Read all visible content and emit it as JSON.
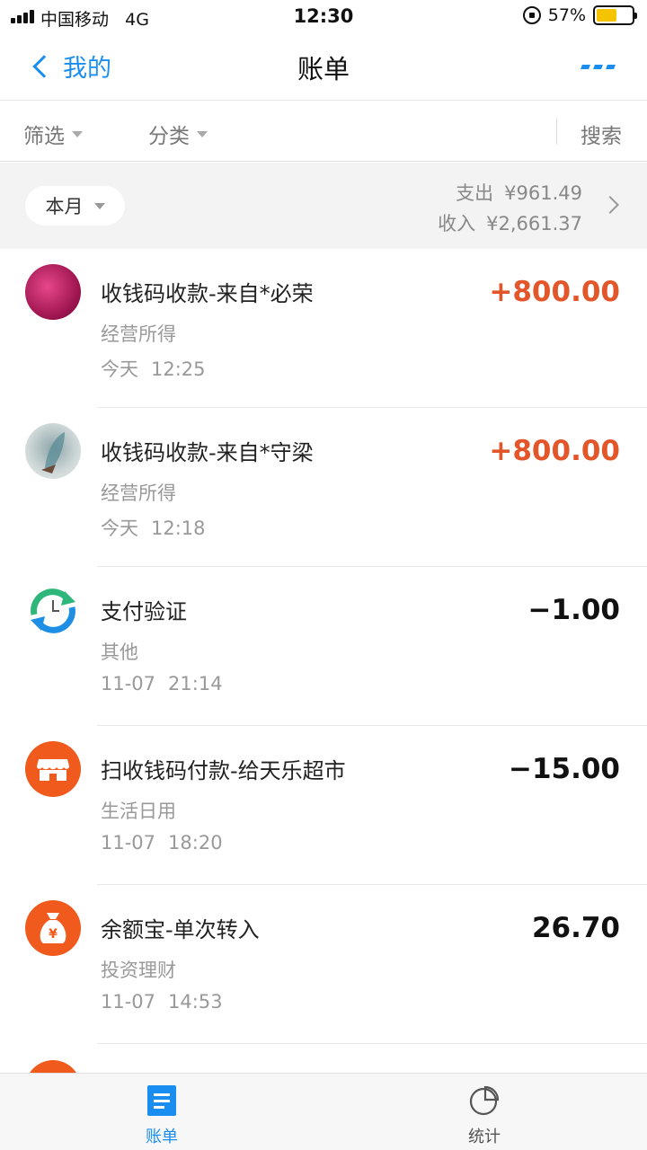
{
  "status_bar": {
    "carrier": "中国移动",
    "network": "4G",
    "time": "12:30",
    "battery": "57%",
    "battery_level": 0.57
  },
  "nav": {
    "back_label": "我的",
    "title": "账单"
  },
  "filters": {
    "filter_label": "筛选",
    "category_label": "分类",
    "search_label": "搜索"
  },
  "summary": {
    "period": "本月",
    "expense_label": "支出",
    "expense_value": "¥961.49",
    "income_label": "收入",
    "income_value": "¥2,661.37"
  },
  "transactions": [
    {
      "title": "收钱码收款-来自*必荣",
      "category": "经营所得",
      "date": "今天",
      "time": "12:25",
      "amount": "+800.00",
      "type": "income"
    },
    {
      "title": "收钱码收款-来自*守梁",
      "category": "经营所得",
      "date": "今天",
      "time": "12:18",
      "amount": "+800.00",
      "type": "income"
    },
    {
      "title": "支付验证",
      "category": "其他",
      "date": "11-07",
      "time": "21:14",
      "amount": "−1.00",
      "type": "expense"
    },
    {
      "title": "扫收钱码付款-给天乐超市",
      "category": "生活日用",
      "date": "11-07",
      "time": "18:20",
      "amount": "−15.00",
      "type": "expense"
    },
    {
      "title": "余额宝-单次转入",
      "category": "投资理财",
      "date": "11-07",
      "time": "14:53",
      "amount": "26.70",
      "type": "neutral"
    }
  ],
  "tabs": {
    "bill_label": "账单",
    "stats_label": "统计"
  },
  "colors": {
    "accent": "#1a8ef0",
    "income": "#e2562a",
    "orange_icon": "#f05a1c"
  }
}
